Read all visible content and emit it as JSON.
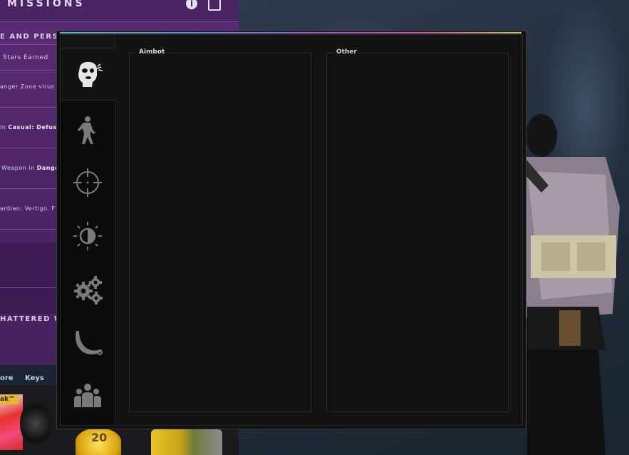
{
  "missions_panel": {
    "title": "MISSIONS",
    "rows": [
      {
        "text": "E AND PERSO",
        "bold": ""
      },
      {
        "text": "Stars Earned",
        "bold": ""
      },
      {
        "text": "anger Zone virus f",
        "bold": ""
      },
      {
        "prefix": "in ",
        "bold": "Casual: Defusa"
      },
      {
        "prefix": "Weapon in ",
        "bold": "Dange"
      },
      {
        "text": "ardian: Vertigo. F",
        "bold": ""
      },
      {
        "text": "HATTERED WE",
        "bold": ""
      }
    ],
    "bottom_tabs": [
      "ore",
      "Keys"
    ],
    "poster_label": "ak™"
  },
  "menu": {
    "tabs": [
      {
        "name": "ragebot",
        "icon": "masked-head-icon",
        "active": true
      },
      {
        "name": "legitbot",
        "icon": "soldier-icon",
        "active": false
      },
      {
        "name": "aim",
        "icon": "crosshair-icon",
        "active": false
      },
      {
        "name": "visuals",
        "icon": "brightness-icon",
        "active": false
      },
      {
        "name": "misc",
        "icon": "gears-icon",
        "active": false
      },
      {
        "name": "skins",
        "icon": "karambit-icon",
        "active": false
      },
      {
        "name": "players",
        "icon": "players-icon",
        "active": false
      }
    ],
    "groups": [
      {
        "title": "Aimbot"
      },
      {
        "title": "Other"
      }
    ]
  },
  "colors": {
    "accent_gradient": [
      "#3bc2d8",
      "#6f7fe6",
      "#b14fd6",
      "#d84fa8",
      "#c8d23c"
    ],
    "menu_bg": "#131314",
    "icon_active": "#e6e6e6",
    "icon_inactive": "#7a7a7c",
    "missions_bg": "#4e2567"
  }
}
